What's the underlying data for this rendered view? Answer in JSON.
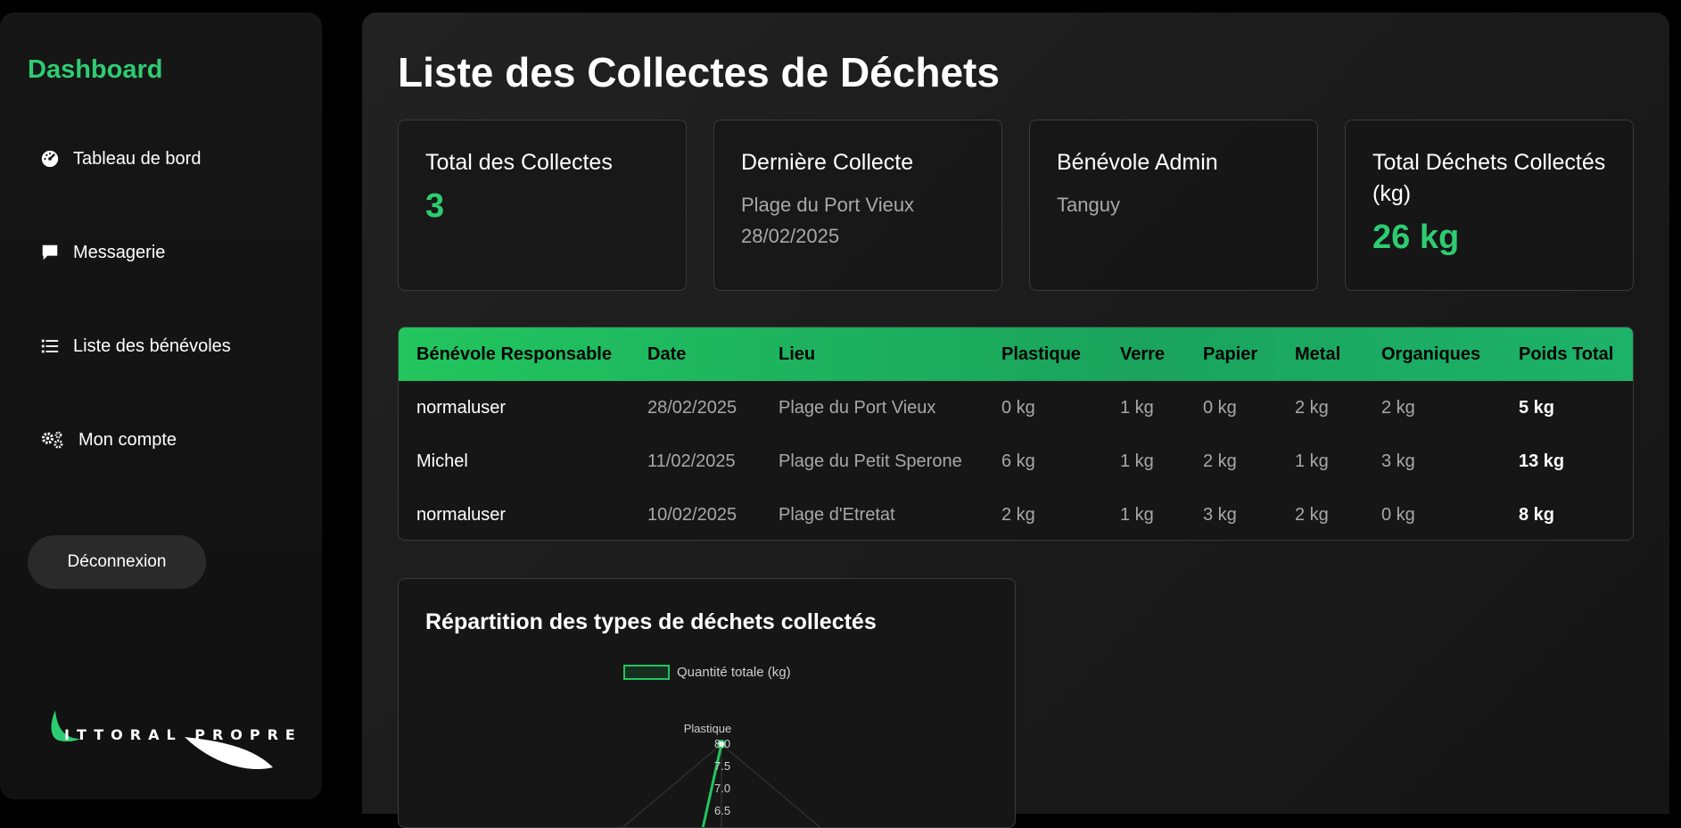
{
  "sidebar": {
    "brand": "Dashboard",
    "items": [
      {
        "label": "Tableau de bord",
        "icon": "dashboard-gauge-icon"
      },
      {
        "label": "Messagerie",
        "icon": "chat-bubble-icon"
      },
      {
        "label": "Liste des bénévoles",
        "icon": "list-icon"
      },
      {
        "label": "Mon compte",
        "icon": "cogs-icon"
      }
    ],
    "logout_label": "Déconnexion",
    "logo": {
      "text": "ITTORAL PROPRE"
    }
  },
  "main": {
    "title": "Liste des Collectes de Déchets",
    "stats": [
      {
        "label": "Total des Collectes",
        "value": "3"
      },
      {
        "label": "Dernière Collecte",
        "line1": "Plage du Port Vieux",
        "line2": "28/02/2025"
      },
      {
        "label": "Bénévole Admin",
        "value": "Tanguy"
      },
      {
        "label": "Total Déchets Collectés (kg)",
        "value": "26 kg"
      }
    ],
    "table": {
      "headers": [
        "Bénévole Responsable",
        "Date",
        "Lieu",
        "Plastique",
        "Verre",
        "Papier",
        "Metal",
        "Organiques",
        "Poids Total"
      ],
      "rows": [
        [
          "normaluser",
          "28/02/2025",
          "Plage du Port Vieux",
          "0 kg",
          "1 kg",
          "0 kg",
          "2 kg",
          "2 kg",
          "5 kg"
        ],
        [
          "Michel",
          "11/02/2025",
          "Plage du Petit Sperone",
          "6 kg",
          "1 kg",
          "2 kg",
          "1 kg",
          "3 kg",
          "13 kg"
        ],
        [
          "normaluser",
          "10/02/2025",
          "Plage d'Etretat",
          "2 kg",
          "1 kg",
          "3 kg",
          "2 kg",
          "0 kg",
          "8 kg"
        ]
      ]
    }
  },
  "chart_data": {
    "type": "radar",
    "title": "Répartition des types de déchets collectés",
    "legend": [
      "Quantité totale (kg)"
    ],
    "categories": [
      "Plastique"
    ],
    "series": [
      {
        "name": "Quantité totale (kg)",
        "values": [
          8.0
        ]
      }
    ],
    "ticks": [
      "8.0",
      "7.5",
      "7.0",
      "6.5"
    ],
    "colors": {
      "series": "#22c55e",
      "grid": "#3a3a3a"
    }
  },
  "colors": {
    "accent": "#2ecc71",
    "header_green": "#22c55e"
  }
}
